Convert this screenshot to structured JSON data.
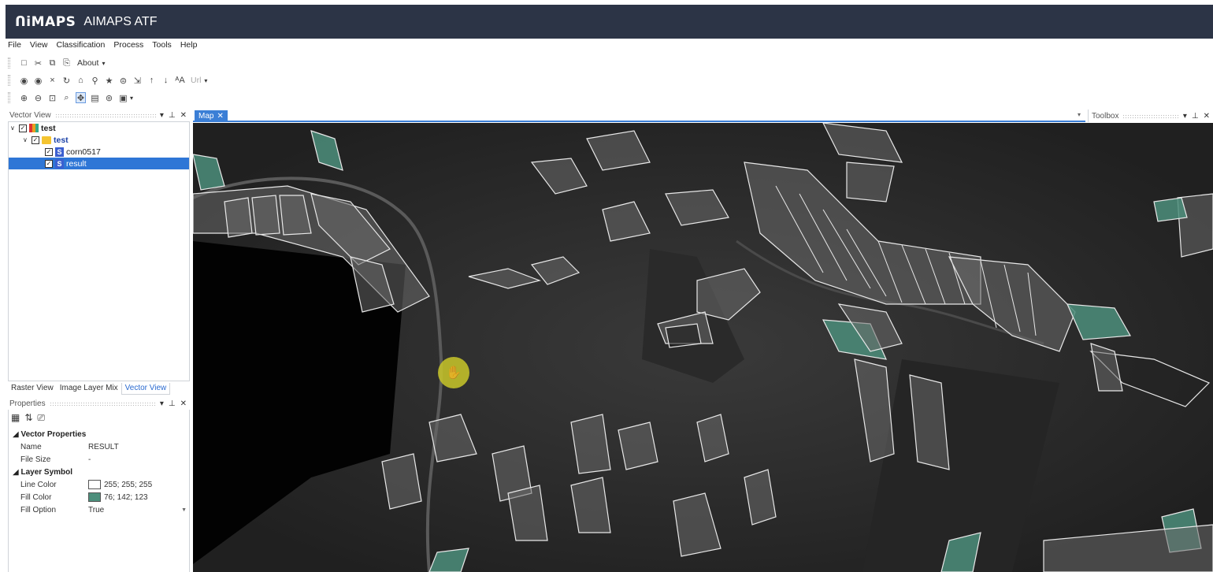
{
  "app": {
    "logo": "ᑎiMAPS",
    "title": "AIMAPS ATF"
  },
  "menu": [
    "File",
    "View",
    "Classification",
    "Process",
    "Tools",
    "Help"
  ],
  "toolbar1": {
    "about_label": "About"
  },
  "toolbar2": {
    "url_label": "Url"
  },
  "vector_view": {
    "title": "Vector View",
    "tree": [
      {
        "label": "test",
        "level": 0
      },
      {
        "label": "test",
        "level": 1
      },
      {
        "label": "corn0517",
        "level": 2
      },
      {
        "label": "result",
        "level": 2
      }
    ]
  },
  "bottom_tabs": [
    "Raster View",
    "Image Layer Mix",
    "Vector View"
  ],
  "properties": {
    "title": "Properties",
    "categories": {
      "vector": "Vector Properties",
      "layer": "Layer Symbol"
    },
    "rows": {
      "name": {
        "label": "Name",
        "value": "RESULT"
      },
      "file_size": {
        "label": "File Size",
        "value": "-"
      },
      "line_color": {
        "label": "Line Color",
        "value": "255; 255; 255",
        "swatch": "#ffffff"
      },
      "fill_color": {
        "label": "Fill Color",
        "value": "76; 142; 123",
        "swatch": "#4c8e7b"
      },
      "fill_option": {
        "label": "Fill Option",
        "value": "True"
      }
    }
  },
  "map_tab": {
    "label": "Map"
  },
  "toolbox": {
    "title": "Toolbox"
  },
  "colors": {
    "titlebar": "#2c3446",
    "accent": "#3b7fd6",
    "selection": "#2e76d6",
    "fill": "#4c8e7b",
    "cursor": "#c9c72a"
  }
}
